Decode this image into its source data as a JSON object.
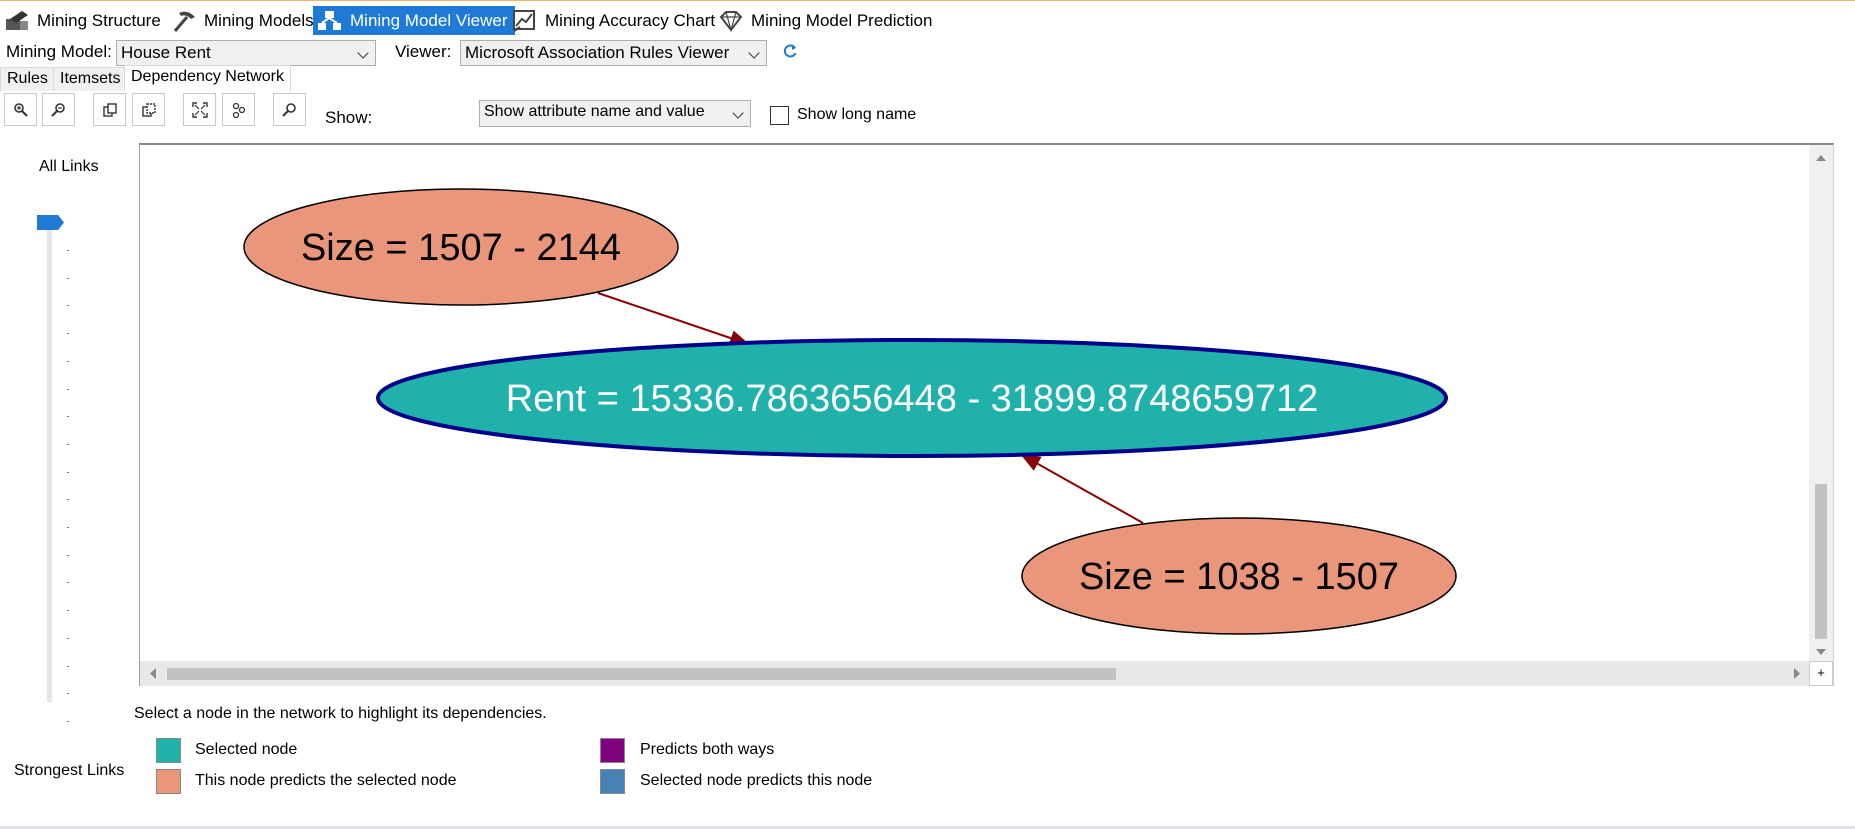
{
  "designer_tabs": [
    {
      "label": "Mining Structure",
      "icon": "mining-structure-icon"
    },
    {
      "label": "Mining Models",
      "icon": "pickaxe-icon"
    },
    {
      "label": "Mining Model Viewer",
      "icon": "model-viewer-icon",
      "active": true
    },
    {
      "label": "Mining Accuracy Chart",
      "icon": "accuracy-chart-icon"
    },
    {
      "label": "Mining Model Prediction",
      "icon": "diamond-icon"
    }
  ],
  "model_row": {
    "mining_model_label": "Mining Model:",
    "mining_model_value": "House Rent",
    "viewer_label": "Viewer:",
    "viewer_value": "Microsoft Association Rules Viewer"
  },
  "sub_tabs": [
    "Rules",
    "Itemsets",
    "Dependency Network"
  ],
  "toolbar": {
    "show_label": "Show:",
    "show_value": "Show attribute name and value",
    "show_long_name_label": "Show long name",
    "show_long_name_checked": false
  },
  "slider": {
    "top_label": "All Links",
    "bottom_label": "Strongest Links",
    "level": 1.0
  },
  "network": {
    "nodes": [
      {
        "label": "Size = 1507 - 2144",
        "role": "predicts-selected"
      },
      {
        "label": "Rent = 15336.7863656448 - 31899.8748659712",
        "role": "selected"
      },
      {
        "label": "Size = 1038 - 1507",
        "role": "predicts-selected"
      }
    ]
  },
  "status_text": "Select a node in the network to highlight its dependencies.",
  "legend": [
    {
      "label": "Selected node",
      "color": "#20b2aa"
    },
    {
      "label": "This node predicts the selected node",
      "color": "#e9967a"
    },
    {
      "label": "Predicts both ways",
      "color": "#800080"
    },
    {
      "label": "Selected node predicts this node",
      "color": "#4682b4"
    }
  ],
  "colors": {
    "accent": "#1f7ad6",
    "edge": "#8b0000",
    "selected_border": "#00008b"
  }
}
